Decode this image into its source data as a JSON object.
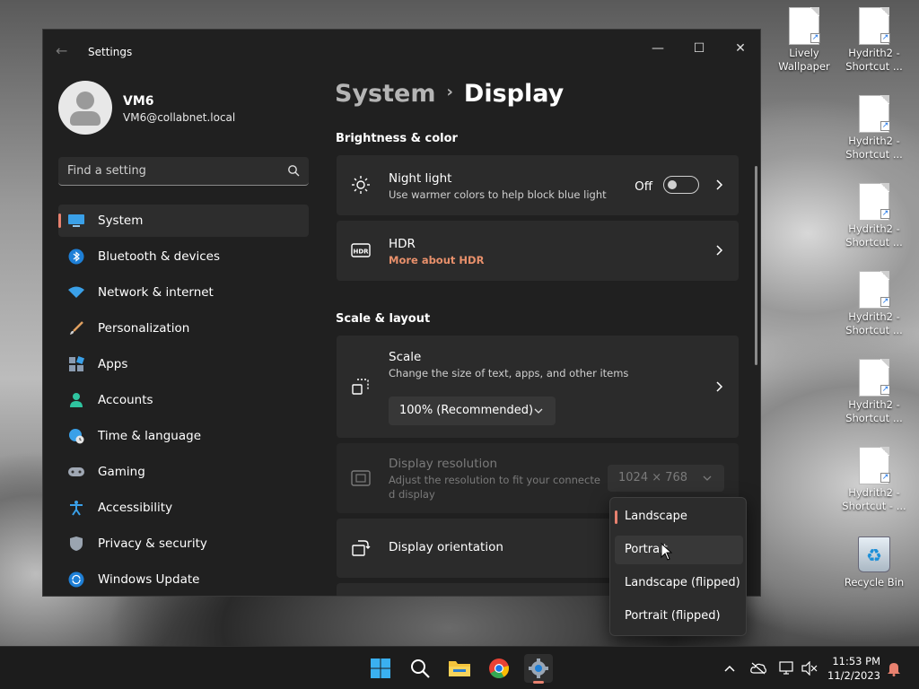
{
  "desktop": {
    "icons": [
      {
        "line1": "Lively",
        "line2": "Wallpaper"
      },
      {
        "line1": "Hydrith2 -",
        "line2": "Shortcut ..."
      },
      {
        "line1": "Hydrith2 -",
        "line2": "Shortcut ..."
      },
      {
        "line1": "Hydrith2 -",
        "line2": "Shortcut ..."
      },
      {
        "line1": "Hydrith2 -",
        "line2": "Shortcut ..."
      },
      {
        "line1": "Hydrith2 -",
        "line2": "Shortcut ..."
      },
      {
        "line1": "Hydrith2 -",
        "line2": "Shortcut - ..."
      }
    ],
    "recycle_bin": "Recycle Bin"
  },
  "window": {
    "title": "Settings",
    "controls": {
      "minimize": "—",
      "maximize": "☐",
      "close": "✕"
    }
  },
  "profile": {
    "name": "VM6",
    "email": "VM6@collabnet.local"
  },
  "search": {
    "placeholder": "Find a setting"
  },
  "nav": [
    {
      "label": "System"
    },
    {
      "label": "Bluetooth & devices"
    },
    {
      "label": "Network & internet"
    },
    {
      "label": "Personalization"
    },
    {
      "label": "Apps"
    },
    {
      "label": "Accounts"
    },
    {
      "label": "Time & language"
    },
    {
      "label": "Gaming"
    },
    {
      "label": "Accessibility"
    },
    {
      "label": "Privacy & security"
    },
    {
      "label": "Windows Update"
    }
  ],
  "breadcrumb": {
    "parent": "System",
    "separator": "›",
    "current": "Display"
  },
  "sections": {
    "brightness": "Brightness & color",
    "scale_layout": "Scale & layout"
  },
  "night_light": {
    "title": "Night light",
    "subtitle": "Use warmer colors to help block blue light",
    "state_label": "Off"
  },
  "hdr": {
    "title": "HDR",
    "link": "More about HDR"
  },
  "scale": {
    "title": "Scale",
    "subtitle": "Change the size of text, apps, and other items",
    "value": "100% (Recommended)"
  },
  "resolution": {
    "title": "Display resolution",
    "subtitle_line1": "Adjust the resolution to fit your connecte",
    "subtitle_line2": "d display",
    "value": "1024 × 768"
  },
  "orientation": {
    "title": "Display orientation",
    "options": [
      "Landscape",
      "Portrait",
      "Landscape (flipped)",
      "Portrait (flipped)"
    ],
    "selected": "Landscape",
    "hovered": "Portrait"
  },
  "taskbar": {
    "clock_time": "11:53 PM",
    "clock_date": "11/2/2023"
  },
  "colors": {
    "accent": "#e8816f",
    "link": "#e8906b",
    "window_bg": "#202020",
    "card_bg": "#2b2b2b"
  }
}
